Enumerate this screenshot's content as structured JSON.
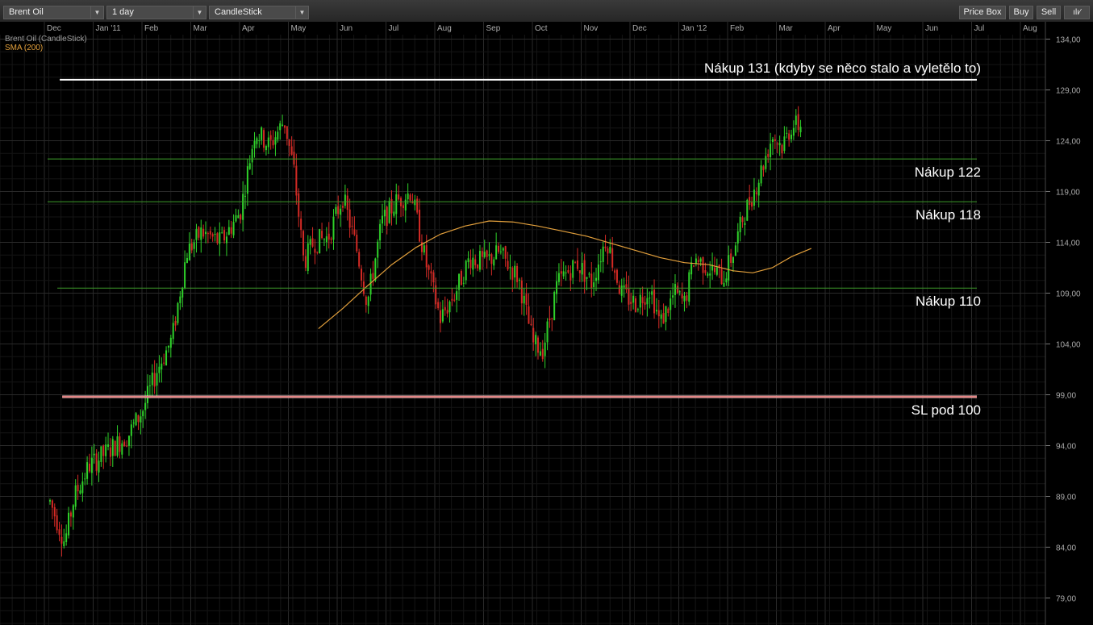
{
  "toolbar": {
    "instrument": "Brent Oil",
    "period": "1 day",
    "chart_type": "CandleStick",
    "price_box": "Price Box",
    "buy": "Buy",
    "sell": "Sell",
    "icons": [
      "bars-icon",
      "pencil-icon"
    ]
  },
  "legend": {
    "series_label": "Brent Oil (CandleStick)",
    "sma_label": "SMA (200)",
    "sma_color": "#e3a03c"
  },
  "colors": {
    "up": "#2fd12a",
    "down": "#d42a25",
    "grid": "#2a2a2a",
    "level": "#3d9b2a"
  },
  "chart_data": {
    "type": "candlestick",
    "x_labels": [
      "Dec",
      "Jan '11",
      "Feb",
      "Mar",
      "Apr",
      "May",
      "Jun",
      "Jul",
      "Aug",
      "Sep",
      "Oct",
      "Nov",
      "Dec",
      "Jan '12",
      "Feb",
      "Mar",
      "Apr",
      "May",
      "Jun",
      "Jul",
      "Aug"
    ],
    "y_ticks": [
      "134,00",
      "129,00",
      "124,00",
      "119,00",
      "114,00",
      "109,00",
      "104,00",
      "99,00",
      "94,00",
      "89,00",
      "84,00",
      "79,00"
    ],
    "ylim": [
      77.5,
      135.5
    ],
    "price_path": [
      {
        "m": 0.0,
        "p": 88.5
      },
      {
        "m": 0.3,
        "p": 84.5
      },
      {
        "m": 0.5,
        "p": 89
      },
      {
        "m": 0.8,
        "p": 92
      },
      {
        "m": 1.2,
        "p": 93.5
      },
      {
        "m": 1.6,
        "p": 95
      },
      {
        "m": 1.9,
        "p": 97.5
      },
      {
        "m": 2.2,
        "p": 101.5
      },
      {
        "m": 2.5,
        "p": 104.5
      },
      {
        "m": 2.8,
        "p": 113
      },
      {
        "m": 3.1,
        "p": 115
      },
      {
        "m": 3.5,
        "p": 114
      },
      {
        "m": 3.9,
        "p": 117
      },
      {
        "m": 4.2,
        "p": 125
      },
      {
        "m": 4.5,
        "p": 123.5
      },
      {
        "m": 4.8,
        "p": 126
      },
      {
        "m": 5.0,
        "p": 121
      },
      {
        "m": 5.2,
        "p": 112
      },
      {
        "m": 5.4,
        "p": 114
      },
      {
        "m": 5.7,
        "p": 114.5
      },
      {
        "m": 6.0,
        "p": 118.5
      },
      {
        "m": 6.3,
        "p": 113
      },
      {
        "m": 6.5,
        "p": 108
      },
      {
        "m": 6.8,
        "p": 116
      },
      {
        "m": 7.1,
        "p": 118
      },
      {
        "m": 7.4,
        "p": 119
      },
      {
        "m": 7.7,
        "p": 112
      },
      {
        "m": 8.0,
        "p": 106.5
      },
      {
        "m": 8.3,
        "p": 109
      },
      {
        "m": 8.6,
        "p": 112.5
      },
      {
        "m": 8.9,
        "p": 112
      },
      {
        "m": 9.2,
        "p": 113
      },
      {
        "m": 9.6,
        "p": 110.5
      },
      {
        "m": 9.9,
        "p": 104
      },
      {
        "m": 10.1,
        "p": 103.5
      },
      {
        "m": 10.4,
        "p": 110
      },
      {
        "m": 10.8,
        "p": 112
      },
      {
        "m": 11.1,
        "p": 110
      },
      {
        "m": 11.4,
        "p": 114.5
      },
      {
        "m": 11.7,
        "p": 109
      },
      {
        "m": 12.0,
        "p": 108
      },
      {
        "m": 12.3,
        "p": 109.5
      },
      {
        "m": 12.5,
        "p": 106
      },
      {
        "m": 12.8,
        "p": 109
      },
      {
        "m": 13.0,
        "p": 108
      },
      {
        "m": 13.2,
        "p": 112.5
      },
      {
        "m": 13.5,
        "p": 111.5
      },
      {
        "m": 13.8,
        "p": 110.5
      },
      {
        "m": 14.0,
        "p": 113
      },
      {
        "m": 14.2,
        "p": 116.5
      },
      {
        "m": 14.5,
        "p": 120
      },
      {
        "m": 14.8,
        "p": 124.5
      },
      {
        "m": 15.0,
        "p": 123.5
      },
      {
        "m": 15.2,
        "p": 125.5
      },
      {
        "m": 15.4,
        "p": 125.5
      }
    ],
    "sma_path": [
      {
        "m": 5.5,
        "p": 105.5
      },
      {
        "m": 6.0,
        "p": 107.5
      },
      {
        "m": 6.5,
        "p": 109.7
      },
      {
        "m": 7.0,
        "p": 111.8
      },
      {
        "m": 7.5,
        "p": 113.5
      },
      {
        "m": 8.0,
        "p": 114.8
      },
      {
        "m": 8.5,
        "p": 115.6
      },
      {
        "m": 9.0,
        "p": 116.1
      },
      {
        "m": 9.5,
        "p": 116.0
      },
      {
        "m": 10.0,
        "p": 115.6
      },
      {
        "m": 10.5,
        "p": 115.1
      },
      {
        "m": 11.0,
        "p": 114.6
      },
      {
        "m": 11.5,
        "p": 113.9
      },
      {
        "m": 12.0,
        "p": 113.2
      },
      {
        "m": 12.5,
        "p": 112.5
      },
      {
        "m": 13.0,
        "p": 112.0
      },
      {
        "m": 13.5,
        "p": 111.8
      },
      {
        "m": 14.0,
        "p": 111.2
      },
      {
        "m": 14.4,
        "p": 111.0
      },
      {
        "m": 14.8,
        "p": 111.5
      },
      {
        "m": 15.2,
        "p": 112.6
      },
      {
        "m": 15.6,
        "p": 113.4
      }
    ],
    "levels": [
      {
        "price": 130.0,
        "label": "Nákup 131 (kdyby se něco stalo a vyletělo to)",
        "color": "#ffffff",
        "width": 2,
        "from_m": 0.2,
        "label_above": true
      },
      {
        "price": 122.2,
        "label": "Nákup 122",
        "color": "#3d9b2a",
        "width": 1,
        "from_m": -0.05,
        "label_above": false
      },
      {
        "price": 118.0,
        "label": "Nákup 118",
        "color": "#3d9b2a",
        "width": 1,
        "from_m": -0.05,
        "label_above": false
      },
      {
        "price": 109.5,
        "label": "Nákup 110",
        "color": "#3d9b2a",
        "width": 1,
        "from_m": 0.15,
        "label_above": false
      },
      {
        "price": 98.8,
        "label": "SL pod 100",
        "color": "#ffd0d0",
        "width": 3,
        "from_m": 0.25,
        "label_above": false
      }
    ]
  }
}
